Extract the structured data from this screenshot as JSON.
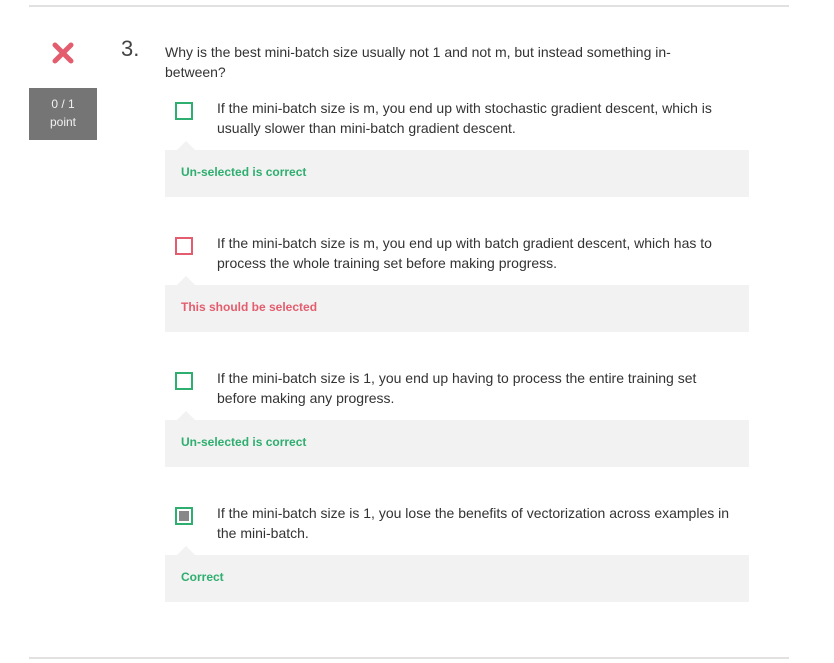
{
  "question": {
    "number": "3.",
    "text": "Why is the best mini-batch size usually not 1 and not m, but instead something in-between?",
    "status_icon": "x-mark-icon",
    "score": {
      "value": "0 / 1",
      "unit": "point"
    }
  },
  "options": [
    {
      "text": "If the mini-batch size is m, you end up with stochastic gradient descent, which is usually slower than mini-batch gradient descent.",
      "selected": false,
      "feedback": "Un-selected is correct",
      "feedback_status": "correct"
    },
    {
      "text": "If the mini-batch size is m, you end up with batch gradient descent, which has to process the whole training set before making progress.",
      "selected": false,
      "feedback": "This should be selected",
      "feedback_status": "incorrect"
    },
    {
      "text": "If the mini-batch size is 1, you end up having to process the entire training set before making any progress.",
      "selected": false,
      "feedback": "Un-selected is correct",
      "feedback_status": "correct"
    },
    {
      "text": "If the mini-batch size is 1, you lose the benefits of vectorization across examples in the mini-batch.",
      "selected": true,
      "feedback": "Correct",
      "feedback_status": "correct"
    }
  ],
  "colors": {
    "correct": "#2eae6f",
    "incorrect": "#e35d6e",
    "score_bg": "#757575",
    "feedback_bg": "#f2f2f2"
  }
}
